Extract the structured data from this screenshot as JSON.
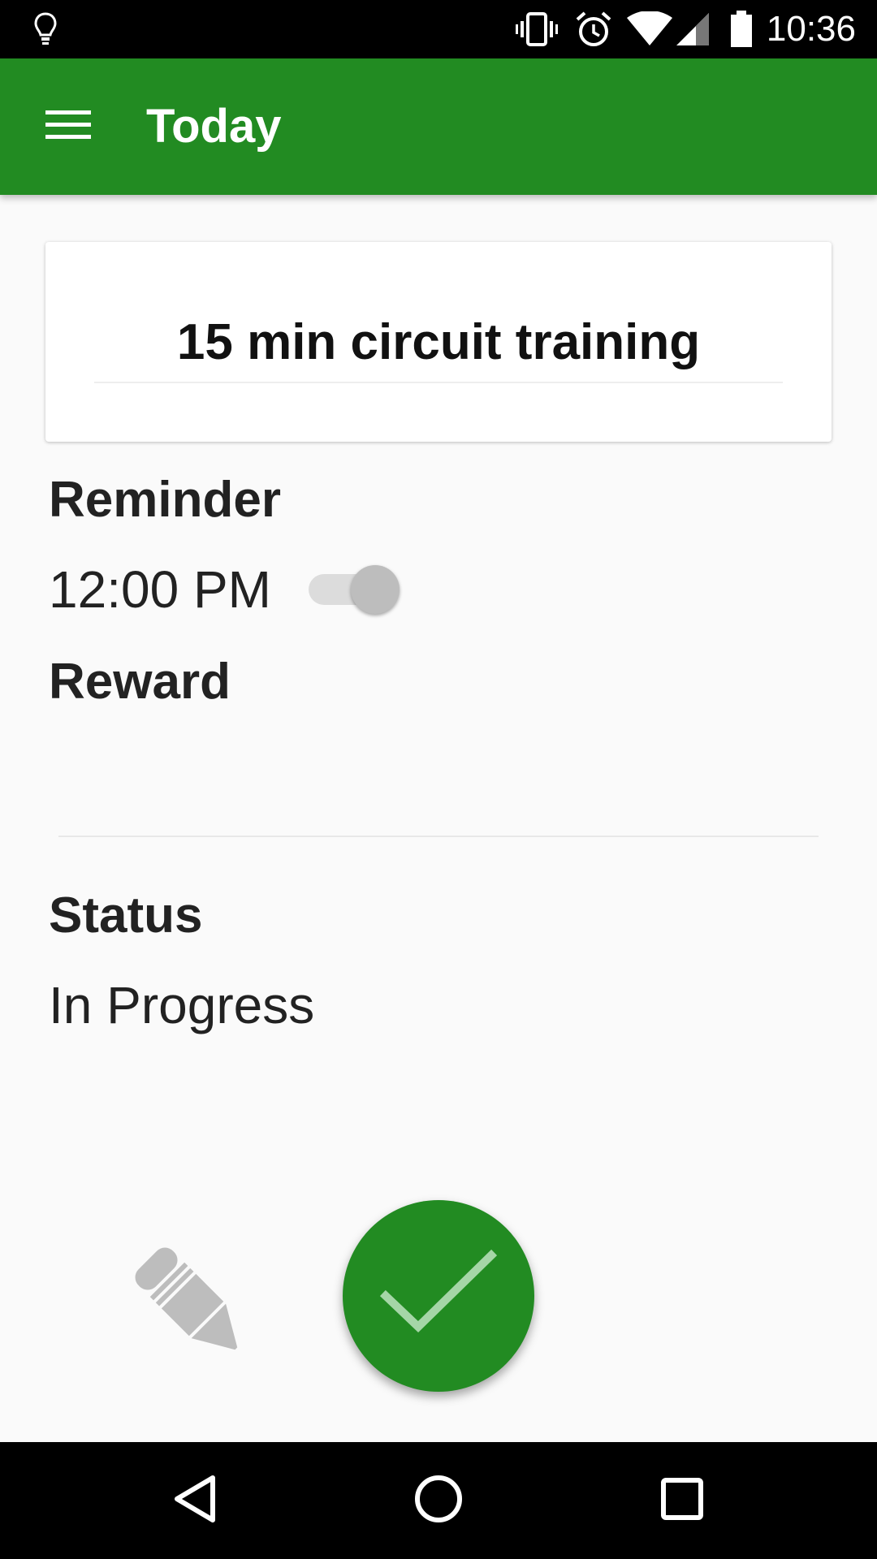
{
  "status_bar": {
    "time": "10:36",
    "icons": [
      "lightbulb-icon",
      "vibrate-icon",
      "alarm-icon",
      "wifi-icon",
      "signal-icon",
      "battery-icon"
    ]
  },
  "app_bar": {
    "title": "Today",
    "menu_icon": "hamburger-menu-icon",
    "color": "#228b22"
  },
  "task": {
    "title": "15 min circuit training"
  },
  "reminder": {
    "label": "Reminder",
    "time": "12:00 PM",
    "enabled": false
  },
  "reward": {
    "label": "Reward",
    "value": ""
  },
  "status": {
    "label": "Status",
    "value": "In Progress"
  },
  "actions": {
    "edit_icon": "pencil-icon",
    "complete_icon": "checkmark-icon",
    "fab_color": "#228b22"
  },
  "nav_bar": {
    "icons": [
      "back-icon",
      "home-icon",
      "recents-icon"
    ]
  }
}
